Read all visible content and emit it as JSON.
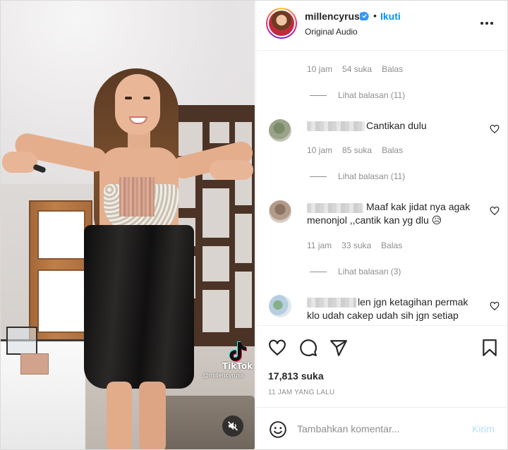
{
  "post": {
    "username": "millencyrus",
    "follow_label": "Ikuti",
    "separator": "•",
    "audio_label": "Original Audio",
    "likes": "17,813 suka",
    "time_ago": "11 JAM YANG LALU"
  },
  "video": {
    "watermark_brand": "TikTok",
    "watermark_handle": "@millencyruss",
    "muted": true
  },
  "comments": [
    {
      "text": "",
      "meta": {
        "time": "10 jam",
        "likes": "54 suka",
        "reply": "Balas"
      },
      "view_replies": "Lihat balasan (11)"
    },
    {
      "text": "Cantikan dulu",
      "meta": {
        "time": "10 jam",
        "likes": "85 suka",
        "reply": "Balas"
      },
      "view_replies": "Lihat balasan (11)"
    },
    {
      "text_line1": "Maaf kak jidat nya agak",
      "text_line2": "menonjol ,,cantik kan yg dlu 😥",
      "meta": {
        "time": "11 jam",
        "likes": "33 suka",
        "reply": "Balas"
      },
      "view_replies": "Lihat balasan (3)"
    },
    {
      "text_line1": "len jgn ketagihan permak",
      "text_line2": "klo udah cakep udah sih jgn setiap"
    }
  ],
  "composer": {
    "placeholder": "Tambahkan komentar...",
    "post_label": "Kirim"
  },
  "colors": {
    "accent": "#0095f6",
    "post_disabled": "#b2dffc",
    "muted_text": "#8e8e8e",
    "text": "#262626",
    "divider": "#efefef"
  },
  "icons": [
    "verified-badge-icon",
    "more-options-icon",
    "heart-icon",
    "comment-icon",
    "share-icon",
    "bookmark-icon",
    "emoji-icon",
    "muted-speaker-icon",
    "tiktok-logo-icon"
  ]
}
